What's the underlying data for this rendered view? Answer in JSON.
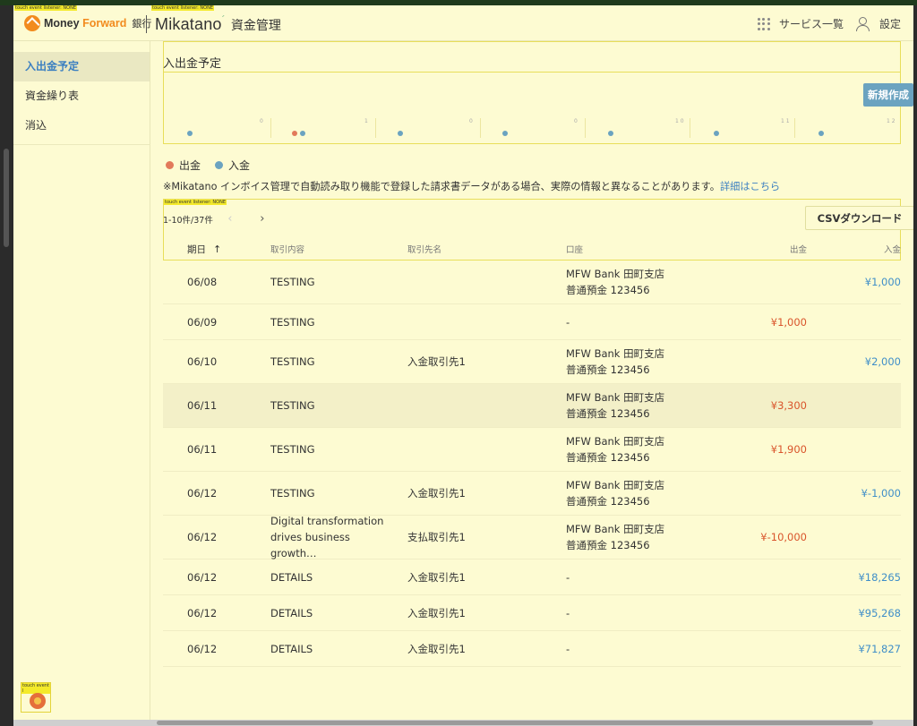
{
  "debug": {
    "label": "touch event listener: NONE",
    "label_short": "touch event l"
  },
  "header": {
    "brand_money": "Money ",
    "brand_forward": "Forward",
    "brand_bank": "銀行",
    "app_name": "Mikatano",
    "app_sub": "資金管理",
    "services_label": "サービス一覧",
    "settings_label": "設定"
  },
  "sidebar": {
    "items": [
      {
        "label": "入出金予定",
        "active": true
      },
      {
        "label": "資金繰り表",
        "active": false
      },
      {
        "label": "消込",
        "active": false
      }
    ]
  },
  "main": {
    "schedule_title": "入出金予定",
    "new_button": "新規作成",
    "timeline_labels": [
      "0",
      "1",
      "0",
      "0",
      "1 0",
      "1 1",
      "1 2"
    ],
    "legend": {
      "out_label": "出金",
      "in_label": "入金"
    },
    "notice_text": "※Mikatano インボイス管理で自動読み取り機能で登録した請求書データがある場合、実際の情報と異なることがあります。",
    "notice_link": "詳細はこちら",
    "pager_text": "1-10件/37件",
    "csv_button": "CSVダウンロード",
    "columns": {
      "date": "期日",
      "content": "取引内容",
      "partner": "取引先名",
      "account": "口座",
      "out": "出金",
      "in": "入金"
    },
    "rows": [
      {
        "date": "06/08",
        "content": "TESTING",
        "partner": "",
        "account1": "MFW Bank 田町支店",
        "account2": "普通預金 123456",
        "out": "",
        "in": "¥1,000"
      },
      {
        "date": "06/09",
        "content": "TESTING",
        "partner": "",
        "account1": "-",
        "account2": "",
        "out": "¥1,000",
        "in": ""
      },
      {
        "date": "06/10",
        "content": "TESTING",
        "partner": "入金取引先1",
        "account1": "MFW Bank 田町支店",
        "account2": "普通預金 123456",
        "out": "",
        "in": "¥2,000"
      },
      {
        "date": "06/11",
        "content": "TESTING",
        "partner": "",
        "account1": "MFW Bank 田町支店",
        "account2": "普通預金 123456",
        "out": "¥3,300",
        "in": ""
      },
      {
        "date": "06/11",
        "content": "TESTING",
        "partner": "",
        "account1": "MFW Bank 田町支店",
        "account2": "普通預金 123456",
        "out": "¥1,900",
        "in": ""
      },
      {
        "date": "06/12",
        "content": "TESTING",
        "partner": "入金取引先1",
        "account1": "MFW Bank 田町支店",
        "account2": "普通預金 123456",
        "out": "",
        "in": "¥-1,000"
      },
      {
        "date": "06/12",
        "content": "Digital transformation drives business growth…",
        "partner": "支払取引先1",
        "account1": "MFW Bank 田町支店",
        "account2": "普通預金 123456",
        "out": "¥-10,000",
        "in": ""
      },
      {
        "date": "06/12",
        "content": "DETAILS",
        "partner": "入金取引先1",
        "account1": "-",
        "account2": "",
        "out": "",
        "in": "¥18,265"
      },
      {
        "date": "06/12",
        "content": "DETAILS",
        "partner": "入金取引先1",
        "account1": "-",
        "account2": "",
        "out": "",
        "in": "¥95,268"
      },
      {
        "date": "06/12",
        "content": "DETAILS",
        "partner": "入金取引先1",
        "account1": "-",
        "account2": "",
        "out": "",
        "in": "¥71,827"
      }
    ]
  },
  "colors": {
    "accent": "#3b7fc1",
    "out": "#d9542b",
    "in": "#3f8ec8",
    "highlight": "#fdfbd2",
    "button": "#6ba3c0"
  }
}
